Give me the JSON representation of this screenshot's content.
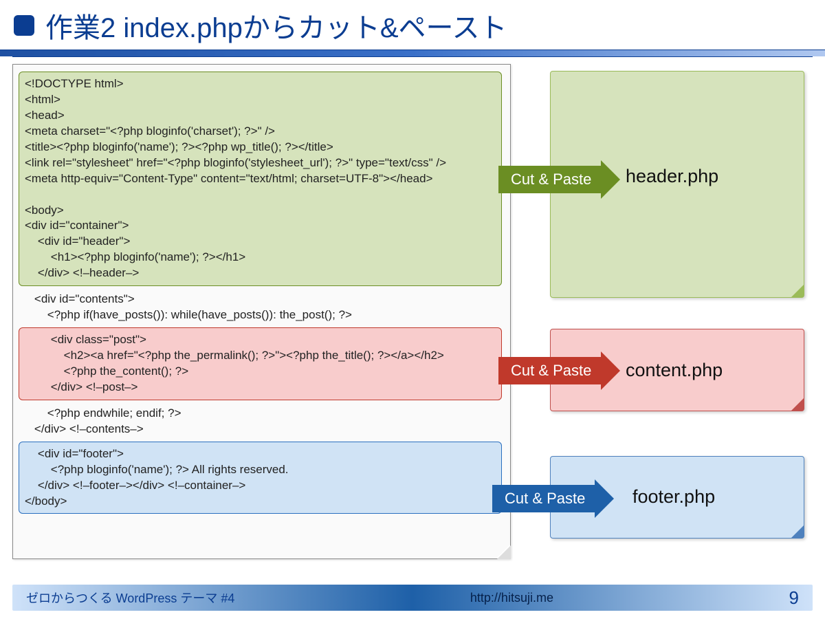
{
  "title": "作業2 index.phpからカット&ペースト",
  "code": {
    "block1": "<!DOCTYPE html>\n<html>\n<head>\n<meta charset=\"<?php bloginfo('charset'); ?>\" />\n<title><?php bloginfo('name'); ?><?php wp_title(); ?></title>\n<link rel=\"stylesheet\" href=\"<?php bloginfo('stylesheet_url'); ?>\" type=\"text/css\" />\n<meta http-equiv=\"Content-Type\" content=\"text/html; charset=UTF-8\"></head>\n\n<body>\n<div id=\"container\">\n    <div id=\"header\">\n        <h1><?php bloginfo('name'); ?></h1>\n    </div> <!–header–>",
    "gap1": "    <div id=\"contents\">\n        <?php if(have_posts()): while(have_posts()): the_post(); ?>",
    "block2": "        <div class=\"post\">\n            <h2><a href=\"<?php the_permalink(); ?>\"><?php the_title(); ?></a></h2>\n            <?php the_content(); ?>\n        </div> <!–post–>",
    "gap2": "        <?php endwhile; endif; ?>\n    </div> <!–contents–>",
    "block3": "    <div id=\"footer\">\n        <?php bloginfo('name'); ?> All rights reserved.\n    </div> <!–footer–></div> <!–container–>\n</body>"
  },
  "arrows": {
    "label": "Cut & Paste"
  },
  "files": {
    "header": "header.php",
    "content": "content.php",
    "footer": "footer.php"
  },
  "footer": {
    "left": "ゼロからつくる WordPress テーマ #4",
    "mid": "http://hitsuji.me",
    "page": "9"
  }
}
